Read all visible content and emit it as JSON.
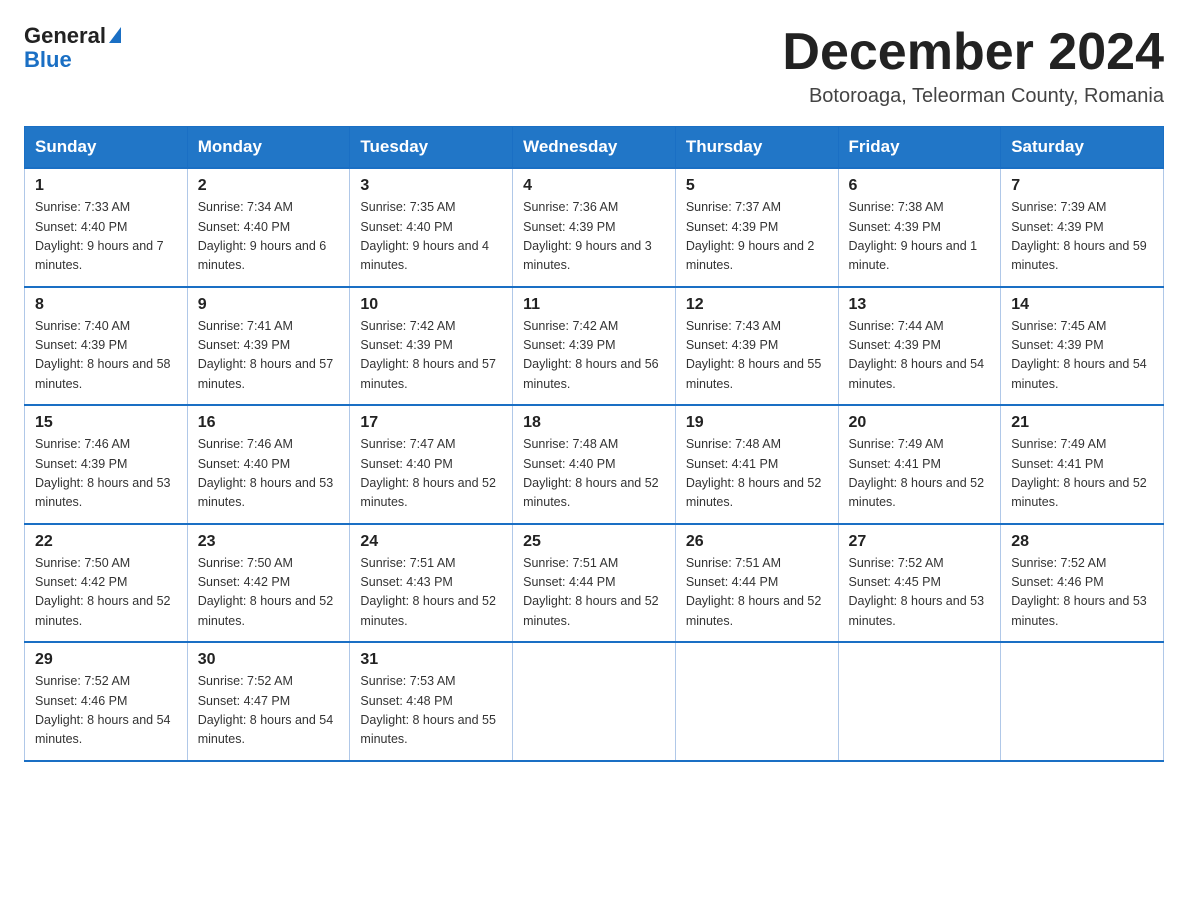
{
  "logo": {
    "general": "General",
    "blue": "Blue",
    "triangle": "▶"
  },
  "title": "December 2024",
  "location": "Botoroaga, Teleorman County, Romania",
  "weekdays": [
    "Sunday",
    "Monday",
    "Tuesday",
    "Wednesday",
    "Thursday",
    "Friday",
    "Saturday"
  ],
  "weeks": [
    [
      {
        "day": "1",
        "sunrise": "7:33 AM",
        "sunset": "4:40 PM",
        "daylight": "9 hours and 7 minutes."
      },
      {
        "day": "2",
        "sunrise": "7:34 AM",
        "sunset": "4:40 PM",
        "daylight": "9 hours and 6 minutes."
      },
      {
        "day": "3",
        "sunrise": "7:35 AM",
        "sunset": "4:40 PM",
        "daylight": "9 hours and 4 minutes."
      },
      {
        "day": "4",
        "sunrise": "7:36 AM",
        "sunset": "4:39 PM",
        "daylight": "9 hours and 3 minutes."
      },
      {
        "day": "5",
        "sunrise": "7:37 AM",
        "sunset": "4:39 PM",
        "daylight": "9 hours and 2 minutes."
      },
      {
        "day": "6",
        "sunrise": "7:38 AM",
        "sunset": "4:39 PM",
        "daylight": "9 hours and 1 minute."
      },
      {
        "day": "7",
        "sunrise": "7:39 AM",
        "sunset": "4:39 PM",
        "daylight": "8 hours and 59 minutes."
      }
    ],
    [
      {
        "day": "8",
        "sunrise": "7:40 AM",
        "sunset": "4:39 PM",
        "daylight": "8 hours and 58 minutes."
      },
      {
        "day": "9",
        "sunrise": "7:41 AM",
        "sunset": "4:39 PM",
        "daylight": "8 hours and 57 minutes."
      },
      {
        "day": "10",
        "sunrise": "7:42 AM",
        "sunset": "4:39 PM",
        "daylight": "8 hours and 57 minutes."
      },
      {
        "day": "11",
        "sunrise": "7:42 AM",
        "sunset": "4:39 PM",
        "daylight": "8 hours and 56 minutes."
      },
      {
        "day": "12",
        "sunrise": "7:43 AM",
        "sunset": "4:39 PM",
        "daylight": "8 hours and 55 minutes."
      },
      {
        "day": "13",
        "sunrise": "7:44 AM",
        "sunset": "4:39 PM",
        "daylight": "8 hours and 54 minutes."
      },
      {
        "day": "14",
        "sunrise": "7:45 AM",
        "sunset": "4:39 PM",
        "daylight": "8 hours and 54 minutes."
      }
    ],
    [
      {
        "day": "15",
        "sunrise": "7:46 AM",
        "sunset": "4:39 PM",
        "daylight": "8 hours and 53 minutes."
      },
      {
        "day": "16",
        "sunrise": "7:46 AM",
        "sunset": "4:40 PM",
        "daylight": "8 hours and 53 minutes."
      },
      {
        "day": "17",
        "sunrise": "7:47 AM",
        "sunset": "4:40 PM",
        "daylight": "8 hours and 52 minutes."
      },
      {
        "day": "18",
        "sunrise": "7:48 AM",
        "sunset": "4:40 PM",
        "daylight": "8 hours and 52 minutes."
      },
      {
        "day": "19",
        "sunrise": "7:48 AM",
        "sunset": "4:41 PM",
        "daylight": "8 hours and 52 minutes."
      },
      {
        "day": "20",
        "sunrise": "7:49 AM",
        "sunset": "4:41 PM",
        "daylight": "8 hours and 52 minutes."
      },
      {
        "day": "21",
        "sunrise": "7:49 AM",
        "sunset": "4:41 PM",
        "daylight": "8 hours and 52 minutes."
      }
    ],
    [
      {
        "day": "22",
        "sunrise": "7:50 AM",
        "sunset": "4:42 PM",
        "daylight": "8 hours and 52 minutes."
      },
      {
        "day": "23",
        "sunrise": "7:50 AM",
        "sunset": "4:42 PM",
        "daylight": "8 hours and 52 minutes."
      },
      {
        "day": "24",
        "sunrise": "7:51 AM",
        "sunset": "4:43 PM",
        "daylight": "8 hours and 52 minutes."
      },
      {
        "day": "25",
        "sunrise": "7:51 AM",
        "sunset": "4:44 PM",
        "daylight": "8 hours and 52 minutes."
      },
      {
        "day": "26",
        "sunrise": "7:51 AM",
        "sunset": "4:44 PM",
        "daylight": "8 hours and 52 minutes."
      },
      {
        "day": "27",
        "sunrise": "7:52 AM",
        "sunset": "4:45 PM",
        "daylight": "8 hours and 53 minutes."
      },
      {
        "day": "28",
        "sunrise": "7:52 AM",
        "sunset": "4:46 PM",
        "daylight": "8 hours and 53 minutes."
      }
    ],
    [
      {
        "day": "29",
        "sunrise": "7:52 AM",
        "sunset": "4:46 PM",
        "daylight": "8 hours and 54 minutes."
      },
      {
        "day": "30",
        "sunrise": "7:52 AM",
        "sunset": "4:47 PM",
        "daylight": "8 hours and 54 minutes."
      },
      {
        "day": "31",
        "sunrise": "7:53 AM",
        "sunset": "4:48 PM",
        "daylight": "8 hours and 55 minutes."
      },
      null,
      null,
      null,
      null
    ]
  ]
}
